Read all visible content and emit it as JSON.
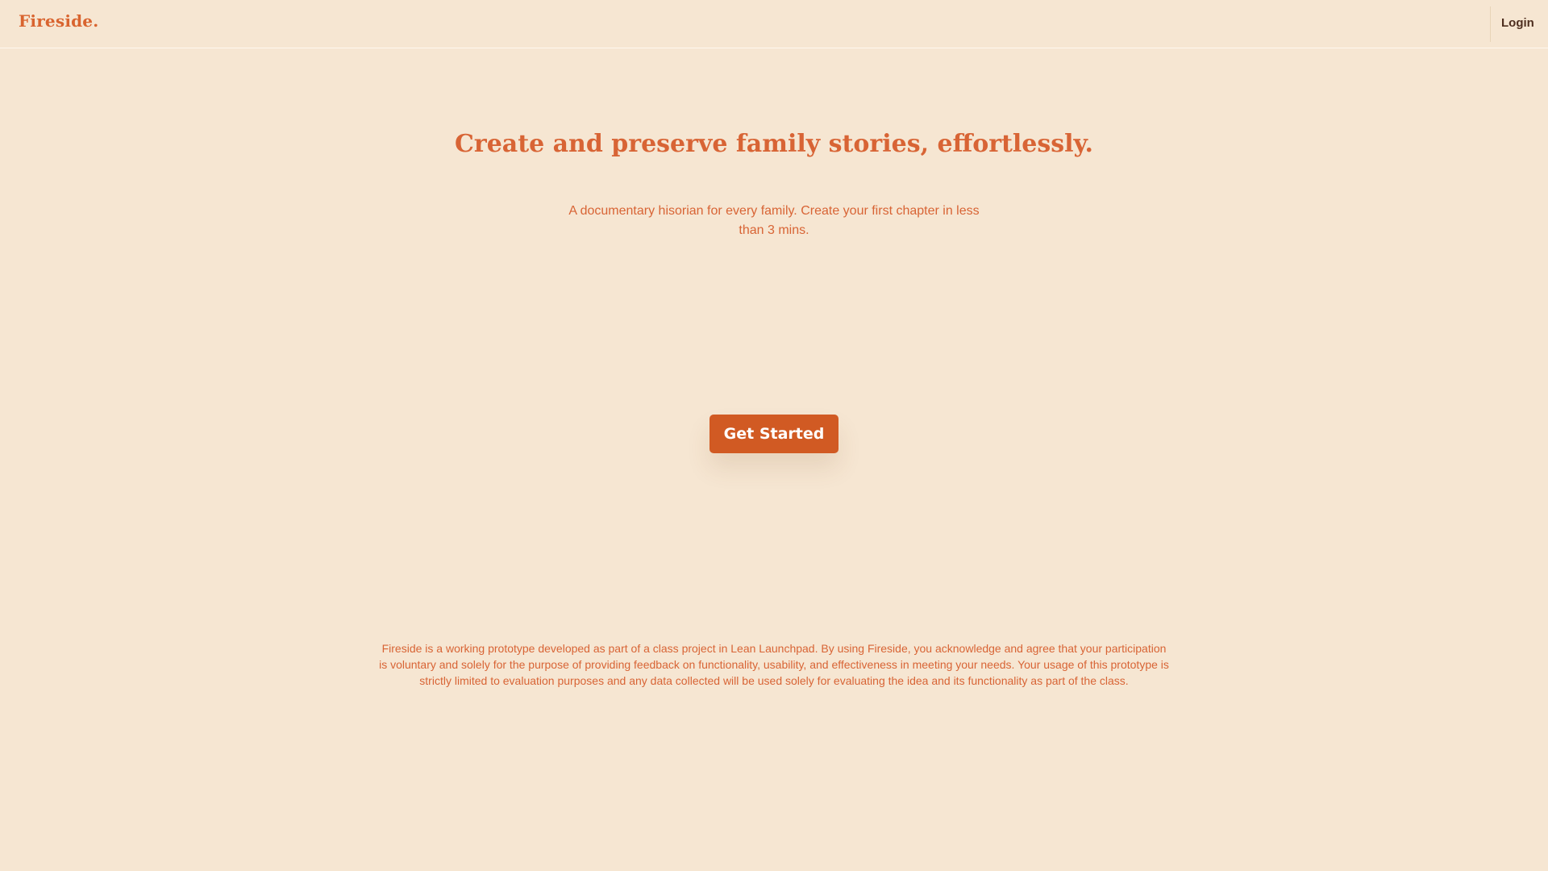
{
  "header": {
    "logo_text": "Fireside.",
    "login_label": "Login"
  },
  "hero": {
    "title": "Create and preserve family stories, effortlessly.",
    "subtitle": "A documentary hisorian for every family. Create your first chapter in less than 3 mins.",
    "cta_label": "Get Started"
  },
  "footer": {
    "disclaimer": "Fireside is a working prototype developed as part of a class project in Lean Launchpad. By using Fireside, you acknowledge and agree that your participation is voluntary and solely for the purpose of providing feedback on functionality, usability, and effectiveness in meeting your needs. Your usage of this prototype is strictly limited to evaluation purposes and any data collected will be used solely for evaluating the idea and its functionality as part of the class."
  },
  "colors": {
    "background": "#F6E6D2",
    "accent": "#D86435",
    "button": "#D15A23",
    "login_text": "#4E2E1F"
  }
}
